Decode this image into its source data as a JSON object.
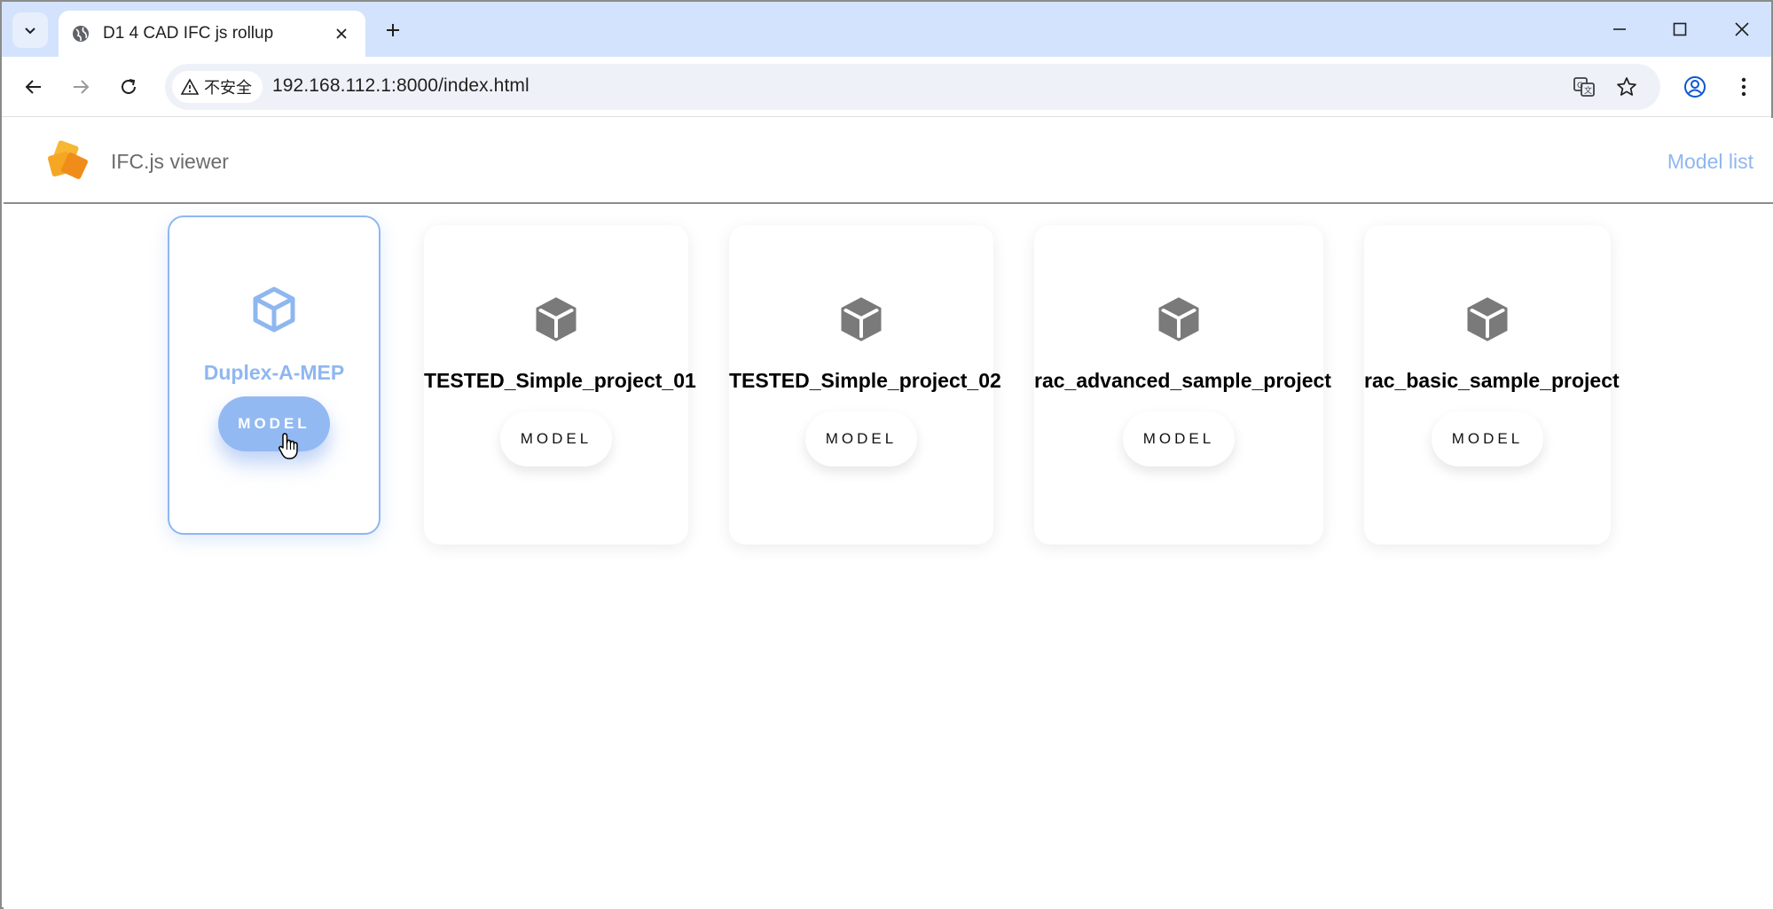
{
  "browser": {
    "tab_title": "D1 4 CAD IFC js rollup",
    "url": "192.168.112.1:8000/index.html",
    "security_label": "不安全"
  },
  "app": {
    "title": "IFC.js viewer",
    "nav_link": "Model list"
  },
  "models": [
    {
      "name": "Duplex-A-MEP",
      "button": "MODEL",
      "hovered": true
    },
    {
      "name": "TESTED_Simple_project_01",
      "button": "MODEL",
      "hovered": false
    },
    {
      "name": "TESTED_Simple_project_02",
      "button": "MODEL",
      "hovered": false
    },
    {
      "name": "rac_advanced_sample_project",
      "button": "MODEL",
      "hovered": false
    },
    {
      "name": "rac_basic_sample_project",
      "button": "MODEL",
      "hovered": false
    }
  ],
  "colors": {
    "accent": "#8fb7ef",
    "tabstrip": "#d3e3fd",
    "logo": "#f5a623"
  },
  "icons": {
    "tab_favicon": "globe-icon",
    "card_icon": "cube-icon",
    "logo": "ifcjs-logo"
  }
}
